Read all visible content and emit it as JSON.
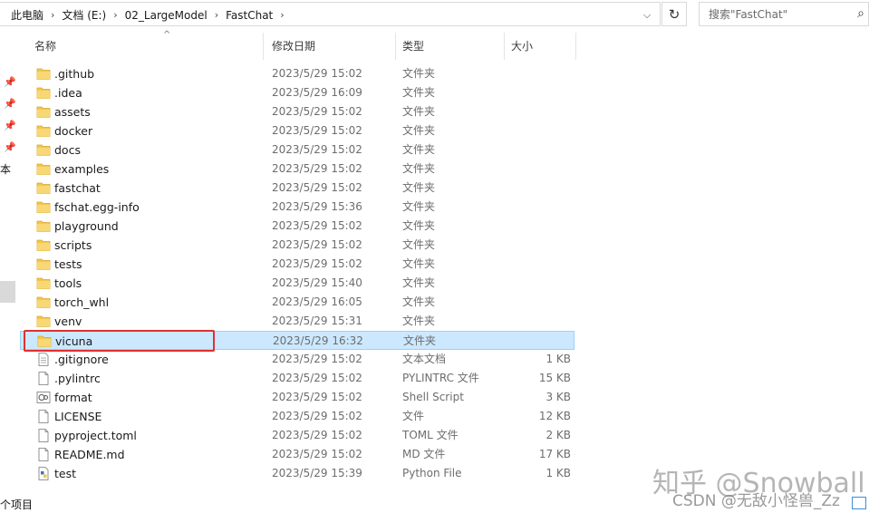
{
  "address_bar": {
    "crumbs": [
      "此电脑",
      "文档 (E:)",
      "02_LargeModel",
      "FastChat"
    ]
  },
  "search": {
    "placeholder": "搜索\"FastChat\""
  },
  "columns": {
    "name": "名称",
    "date": "修改日期",
    "type": "类型",
    "size": "大小"
  },
  "nav_edge": {
    "label_this": "本",
    "status_prefix": "个项目"
  },
  "files": [
    {
      "name": ".github",
      "date": "2023/5/29 15:02",
      "type": "文件夹",
      "size": "",
      "icon": "folder-icon"
    },
    {
      "name": ".idea",
      "date": "2023/5/29 16:09",
      "type": "文件夹",
      "size": "",
      "icon": "folder-icon"
    },
    {
      "name": "assets",
      "date": "2023/5/29 15:02",
      "type": "文件夹",
      "size": "",
      "icon": "folder-icon"
    },
    {
      "name": "docker",
      "date": "2023/5/29 15:02",
      "type": "文件夹",
      "size": "",
      "icon": "folder-icon"
    },
    {
      "name": "docs",
      "date": "2023/5/29 15:02",
      "type": "文件夹",
      "size": "",
      "icon": "folder-icon"
    },
    {
      "name": "examples",
      "date": "2023/5/29 15:02",
      "type": "文件夹",
      "size": "",
      "icon": "folder-icon"
    },
    {
      "name": "fastchat",
      "date": "2023/5/29 15:02",
      "type": "文件夹",
      "size": "",
      "icon": "folder-icon"
    },
    {
      "name": "fschat.egg-info",
      "date": "2023/5/29 15:36",
      "type": "文件夹",
      "size": "",
      "icon": "folder-icon"
    },
    {
      "name": "playground",
      "date": "2023/5/29 15:02",
      "type": "文件夹",
      "size": "",
      "icon": "folder-icon"
    },
    {
      "name": "scripts",
      "date": "2023/5/29 15:02",
      "type": "文件夹",
      "size": "",
      "icon": "folder-icon"
    },
    {
      "name": "tests",
      "date": "2023/5/29 15:02",
      "type": "文件夹",
      "size": "",
      "icon": "folder-icon"
    },
    {
      "name": "tools",
      "date": "2023/5/29 15:40",
      "type": "文件夹",
      "size": "",
      "icon": "folder-icon"
    },
    {
      "name": "torch_whl",
      "date": "2023/5/29 16:05",
      "type": "文件夹",
      "size": "",
      "icon": "folder-icon"
    },
    {
      "name": "venv",
      "date": "2023/5/29 15:31",
      "type": "文件夹",
      "size": "",
      "icon": "folder-icon"
    },
    {
      "name": "vicuna",
      "date": "2023/5/29 16:32",
      "type": "文件夹",
      "size": "",
      "icon": "folder-icon",
      "selected": true
    },
    {
      "name": ".gitignore",
      "date": "2023/5/29 15:02",
      "type": "文本文档",
      "size": "1 KB",
      "icon": "text-file-icon"
    },
    {
      "name": ".pylintrc",
      "date": "2023/5/29 15:02",
      "type": "PYLINTRC 文件",
      "size": "15 KB",
      "icon": "file-icon"
    },
    {
      "name": "format",
      "date": "2023/5/29 15:02",
      "type": "Shell Script",
      "size": "3 KB",
      "icon": "shell-script-icon"
    },
    {
      "name": "LICENSE",
      "date": "2023/5/29 15:02",
      "type": "文件",
      "size": "12 KB",
      "icon": "file-icon"
    },
    {
      "name": "pyproject.toml",
      "date": "2023/5/29 15:02",
      "type": "TOML 文件",
      "size": "2 KB",
      "icon": "file-icon"
    },
    {
      "name": "README.md",
      "date": "2023/5/29 15:02",
      "type": "MD 文件",
      "size": "17 KB",
      "icon": "file-icon"
    },
    {
      "name": "test",
      "date": "2023/5/29 15:39",
      "type": "Python File",
      "size": "1 KB",
      "icon": "python-file-icon"
    }
  ],
  "watermark": {
    "line1": "知乎 @Snowball",
    "line2": "CSDN @无敌小怪兽_Zz"
  },
  "colors": {
    "selection": "#cce8ff",
    "selection_border": "#99d1ff",
    "annotation": "#e03030",
    "folder": "#f3c74e"
  }
}
